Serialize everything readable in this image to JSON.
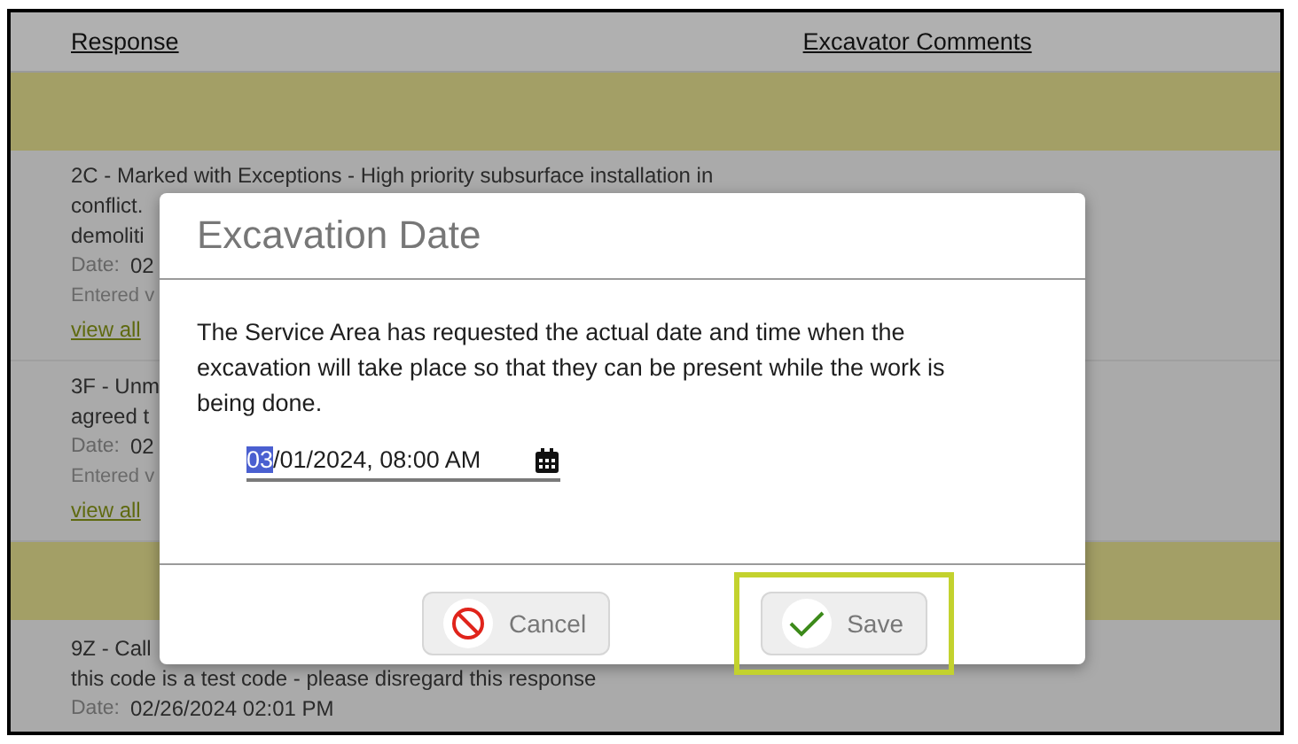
{
  "table": {
    "columns": [
      "Response",
      "Excavator Comments"
    ],
    "rows": [
      {
        "kind": "band"
      },
      {
        "kind": "response",
        "lines": [
          "2C - Marked with Exceptions - High priority subsurface installation in",
          "conflict.",
          "demoliti"
        ],
        "date_label": "Date:",
        "date": "02",
        "entered": "Entered v",
        "link": "view all"
      },
      {
        "kind": "response",
        "lines": [
          "3F - Unm",
          "agreed t"
        ],
        "date_label": "Date:",
        "date": "02",
        "entered": "Entered v",
        "link": "view all"
      },
      {
        "kind": "band"
      },
      {
        "kind": "response",
        "lines": [
          "9Z - Call",
          "this code is a test code - please disregard this response"
        ],
        "date_label": "Date:",
        "date": "02/26/2024 02:01 PM"
      }
    ]
  },
  "dialog": {
    "title": "Excavation Date",
    "message": "The Service Area has requested the actual date and time when the excavation will take place so that they can be present while the work is being done.",
    "field": {
      "value_parts": [
        {
          "text": "03",
          "selected": true
        },
        {
          "text": "/01/2024, 08:00 AM",
          "selected": false
        }
      ]
    },
    "buttons": [
      {
        "kind": "cancel",
        "label": "Cancel",
        "highlighted": false
      },
      {
        "kind": "save",
        "label": "Save",
        "highlighted": true
      }
    ]
  }
}
